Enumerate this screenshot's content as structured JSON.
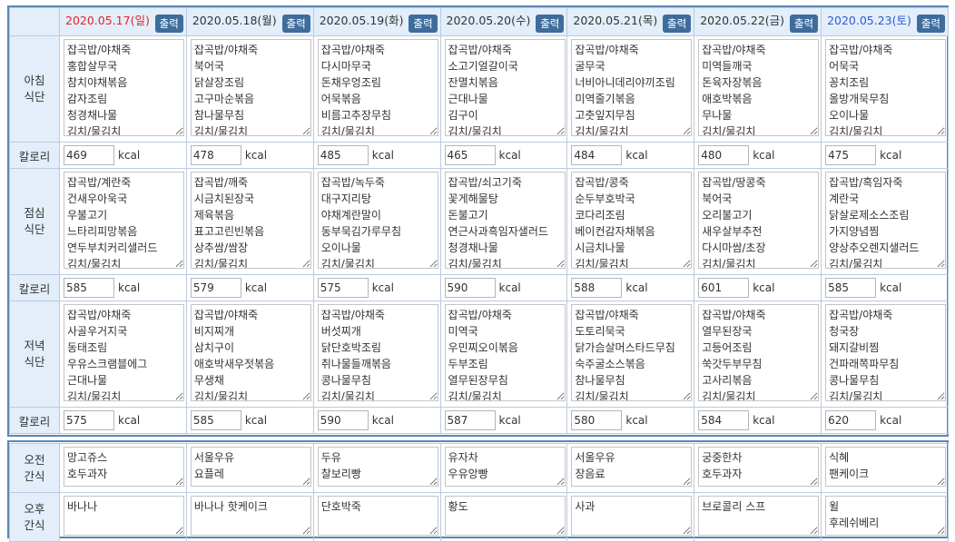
{
  "print_label": "출력",
  "kcal_label": "kcal",
  "row_labels": {
    "breakfast": [
      "아침",
      "식단"
    ],
    "lunch": [
      "점심",
      "식단"
    ],
    "dinner": [
      "저녁",
      "식단"
    ],
    "calorie": "칼로리",
    "am_snack": [
      "오전",
      "간식"
    ],
    "pm_snack": [
      "오후",
      "간식"
    ]
  },
  "colors": {
    "sunday": "#e0242c",
    "weekday": "#333333",
    "saturday": "#2e5bd6",
    "button": "#3e6d9c",
    "header_bg": "#e3eefa"
  },
  "days": [
    {
      "date": "2020.05.17(일)",
      "type": "sun",
      "breakfast": [
        "잡곡밥/야채죽",
        "홍합살무국",
        "참치야채볶음",
        "감자조림",
        "청경채나물",
        "김치/물김치"
      ],
      "breakfast_kcal": "469",
      "lunch": [
        "잡곡밥/계란죽",
        "건새우아욱국",
        "우불고기",
        "느타리피망볶음",
        "연두부치커리샐러드",
        "김치/물김치"
      ],
      "lunch_kcal": "585",
      "dinner": [
        "잡곡밥/야채죽",
        "사골우거지국",
        "동태조림",
        "우유스크램블에그",
        "근대나물",
        "김치/물김치"
      ],
      "dinner_kcal": "575",
      "am_snack": [
        "망고쥬스",
        "호두과자"
      ],
      "pm_snack": [
        "바나나"
      ]
    },
    {
      "date": "2020.05.18(월)",
      "type": "wk",
      "breakfast": [
        "잡곡밥/야채죽",
        "북어국",
        "닭살장조림",
        "고구마순볶음",
        "참나물무침",
        "김치/물김치"
      ],
      "breakfast_kcal": "478",
      "lunch": [
        "잡곡밥/깨죽",
        "시금치된장국",
        "제육볶음",
        "표고고린빈볶음",
        "상추쌈/쌈장",
        "김치/물김치"
      ],
      "lunch_kcal": "579",
      "dinner": [
        "잡곡밥/야채죽",
        "비지찌개",
        "삼치구이",
        "애호박새우젓볶음",
        "무생채",
        "김치/물김치"
      ],
      "dinner_kcal": "585",
      "am_snack": [
        "서울우유",
        "요플레"
      ],
      "pm_snack": [
        "바나나 핫케이크"
      ]
    },
    {
      "date": "2020.05.19(화)",
      "type": "wk",
      "breakfast": [
        "잡곡밥/야채죽",
        "다시마무국",
        "돈채우엉조림",
        "어묵볶음",
        "비름고추장무침",
        "김치/물김치"
      ],
      "breakfast_kcal": "485",
      "lunch": [
        "잡곡밥/녹두죽",
        "대구지리탕",
        "야채계란말이",
        "동부묵김가루무침",
        "오이나물",
        "김치/물김치"
      ],
      "lunch_kcal": "575",
      "dinner": [
        "잡곡밥/야채죽",
        "버섯찌개",
        "닭단호박조림",
        "취나물들깨볶음",
        "콩나물무침",
        "김치/물김치"
      ],
      "dinner_kcal": "590",
      "am_snack": [
        "두유",
        "찰보리빵"
      ],
      "pm_snack": [
        "단호박죽"
      ]
    },
    {
      "date": "2020.05.20(수)",
      "type": "wk",
      "breakfast": [
        "잡곡밥/야채죽",
        "소고기얼갈이국",
        "잔멸치볶음",
        "근대나물",
        "김구이",
        "김치/물김치"
      ],
      "breakfast_kcal": "465",
      "lunch": [
        "잡곡밥/쇠고기죽",
        "꽃게해물탕",
        "돈불고기",
        "연근사과흑임자샐러드",
        "청경채나물",
        "김치/물김치"
      ],
      "lunch_kcal": "590",
      "dinner": [
        "잡곡밥/야채죽",
        "미역국",
        "우민찌오이볶음",
        "두부조림",
        "열무된장무침",
        "김치/물김치"
      ],
      "dinner_kcal": "587",
      "am_snack": [
        "유자차",
        "우유앙빵"
      ],
      "pm_snack": [
        "황도"
      ]
    },
    {
      "date": "2020.05.21(목)",
      "type": "wk",
      "breakfast": [
        "잡곡밥/야채죽",
        "굴무국",
        "너비아니데리야끼조림",
        "미역줄기볶음",
        "고춧잎지무침",
        "김치/물김치"
      ],
      "breakfast_kcal": "484",
      "lunch": [
        "잡곡밥/콩죽",
        "순두부호박국",
        "코다리조림",
        "베이컨감자채볶음",
        "시금치나물",
        "김치/물김치"
      ],
      "lunch_kcal": "588",
      "dinner": [
        "잡곡밥/야채죽",
        "도토리묵국",
        "닭가슴살머스타드무침",
        "숙주굴소스볶음",
        "참나물무침",
        "김치/물김치"
      ],
      "dinner_kcal": "580",
      "am_snack": [
        "서울우유",
        "장음료"
      ],
      "pm_snack": [
        "사과"
      ]
    },
    {
      "date": "2020.05.22(금)",
      "type": "wk",
      "breakfast": [
        "잡곡밥/야채죽",
        "미역들깨국",
        "돈육자장볶음",
        "애호박볶음",
        "무나물",
        "김치/물김치"
      ],
      "breakfast_kcal": "480",
      "lunch": [
        "잡곡밥/땅콩죽",
        "북어국",
        "오리불고기",
        "새우살부추전",
        "다시마쌈/초장",
        "김치/물김치"
      ],
      "lunch_kcal": "601",
      "dinner": [
        "잡곡밥/야채죽",
        "열무된장국",
        "고등어조림",
        "쑥갓두부무침",
        "고사리볶음",
        "김치/물김치"
      ],
      "dinner_kcal": "584",
      "am_snack": [
        "궁중한차",
        "호두과자"
      ],
      "pm_snack": [
        "브로콜리 스프"
      ]
    },
    {
      "date": "2020.05.23(토)",
      "type": "sat",
      "breakfast": [
        "잡곡밥/야채죽",
        "어묵국",
        "꽁치조림",
        "올방개묵무침",
        "오이나물",
        "김치/물김치"
      ],
      "breakfast_kcal": "475",
      "lunch": [
        "잡곡밥/흑임자죽",
        "계란국",
        "닭살로제소스조림",
        "가지양념찜",
        "양상추오렌지샐러드",
        "김치/물김치"
      ],
      "lunch_kcal": "585",
      "dinner": [
        "잡곡밥/야채죽",
        "청국장",
        "돼지갈비찜",
        "건파래쪽파무침",
        "콩나물무침",
        "김치/물김치"
      ],
      "dinner_kcal": "620",
      "am_snack": [
        "식혜",
        "팬케이크"
      ],
      "pm_snack": [
        "윌",
        "후레쉬베리"
      ]
    }
  ]
}
